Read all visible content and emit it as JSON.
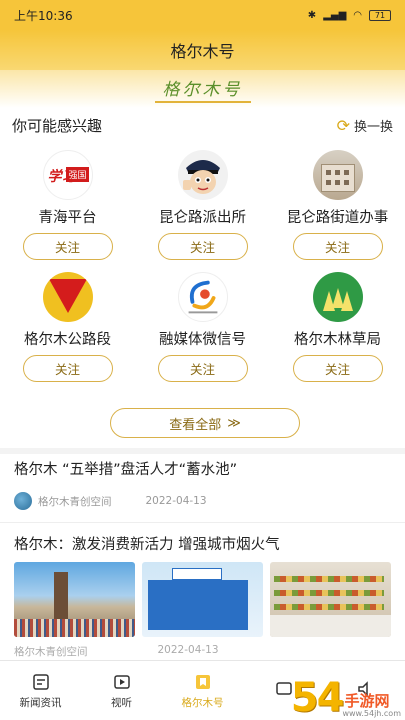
{
  "status": {
    "time": "上午10:36",
    "battery": "71"
  },
  "header": {
    "title": "格尔木号"
  },
  "logo": {
    "text": "格尔木号"
  },
  "recommend": {
    "title": "你可能感兴趣",
    "refresh_label": "换一换",
    "follow_label": "关注",
    "items": [
      {
        "name": "青海平台",
        "avatar": "qinghai",
        "avatar_text1": "学习",
        "avatar_text2": "强国"
      },
      {
        "name": "昆仑路派出所",
        "avatar": "police"
      },
      {
        "name": "昆仑路街道办事",
        "avatar": "street"
      },
      {
        "name": "格尔木公路段",
        "avatar": "road"
      },
      {
        "name": "融媒体微信号",
        "avatar": "media"
      },
      {
        "name": "格尔木林草局",
        "avatar": "forest"
      }
    ],
    "view_all_label": "查看全部",
    "view_all_arrow": "≫"
  },
  "news": [
    {
      "title": "格尔木 “五举措”盘活人才“蓄水池”",
      "source": "格尔木青创空间",
      "date": "2022-04-13"
    },
    {
      "title": "格尔木：激发消费新活力 增强城市烟火气",
      "source": "格尔木青创空间",
      "date": "2022-04-13"
    }
  ],
  "tabs": [
    {
      "label": "新闻资讯",
      "icon": "news-icon",
      "active": false
    },
    {
      "label": "视听",
      "icon": "video-icon",
      "active": false
    },
    {
      "label": "格尔木号",
      "icon": "bookmark-icon",
      "active": true
    },
    {
      "label": "",
      "icon": "message-icon",
      "active": false
    },
    {
      "label": "",
      "icon": "speaker-icon",
      "active": false
    }
  ],
  "watermark": {
    "num": "54",
    "brand": "手游网",
    "url": "www.54jh.com"
  },
  "colors": {
    "brand_yellow": "#f6c53a",
    "accent_gold": "#d9a91a"
  }
}
